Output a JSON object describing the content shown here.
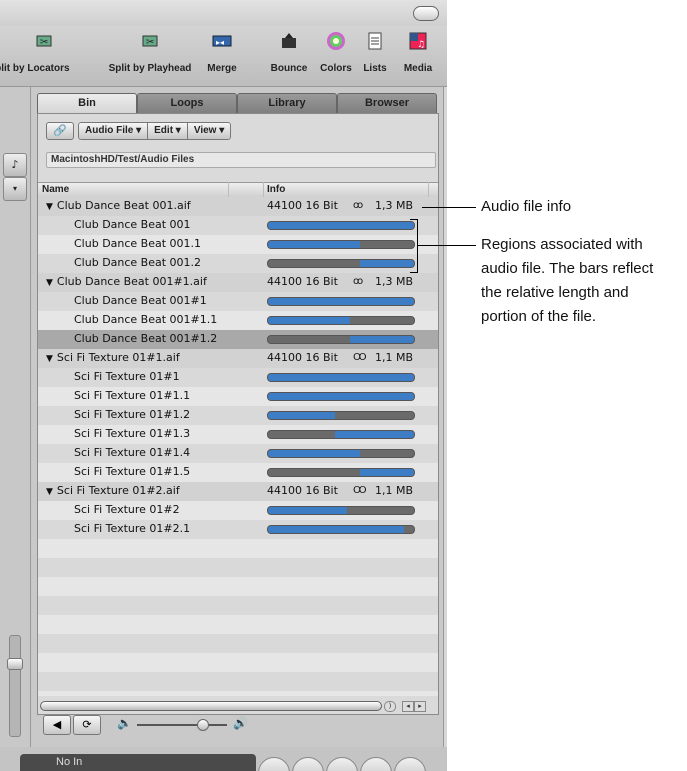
{
  "toolbar": {
    "items": [
      {
        "label": "Split by Locators",
        "icon": "scissors-icon"
      },
      {
        "label": "Split by Playhead",
        "icon": "scissors-icon"
      },
      {
        "label": "Merge",
        "icon": "merge-icon"
      },
      {
        "label": "Bounce",
        "icon": "bounce-icon"
      },
      {
        "label": "Colors",
        "icon": "color-wheel-icon"
      },
      {
        "label": "Lists",
        "icon": "lists-icon"
      },
      {
        "label": "Media",
        "icon": "media-icon"
      }
    ]
  },
  "tabs": [
    {
      "label": "Bin",
      "active": true
    },
    {
      "label": "Loops",
      "active": false
    },
    {
      "label": "Library",
      "active": false
    },
    {
      "label": "Browser",
      "active": false
    }
  ],
  "bin": {
    "menus": [
      "Audio File ▾",
      "Edit ▾",
      "View ▾"
    ],
    "path": "MacintoshHD/Test/Audio Files",
    "columns": {
      "name": "Name",
      "info": "Info"
    },
    "rows": [
      {
        "type": "file",
        "name": "Club Dance Beat 001.aif",
        "rate": "44100 16 Bit",
        "channels": "stereo",
        "size": "1,3 MB"
      },
      {
        "type": "region",
        "name": "Club Dance Beat 001",
        "start": 0.0,
        "length": 1.0
      },
      {
        "type": "region",
        "name": "Club Dance Beat 001.1",
        "start": 0.0,
        "length": 0.63
      },
      {
        "type": "region",
        "name": "Club Dance Beat 001.2",
        "start": 0.63,
        "length": 0.37
      },
      {
        "type": "file",
        "name": "Club Dance Beat 001#1.aif",
        "rate": "44100 16 Bit",
        "channels": "stereo",
        "size": "1,3 MB"
      },
      {
        "type": "region",
        "name": "Club Dance Beat 001#1",
        "start": 0.0,
        "length": 1.0
      },
      {
        "type": "region",
        "name": "Club Dance Beat 001#1.1",
        "start": 0.0,
        "length": 0.56
      },
      {
        "type": "region",
        "name": "Club Dance Beat 001#1.2",
        "start": 0.56,
        "length": 0.44,
        "selected": true
      },
      {
        "type": "file",
        "name": "Sci Fi Texture 01#1.aif",
        "rate": "44100 16 Bit",
        "channels": "mono",
        "size": "1,1 MB"
      },
      {
        "type": "region",
        "name": "Sci Fi Texture 01#1",
        "start": 0.0,
        "length": 1.0
      },
      {
        "type": "region",
        "name": "Sci Fi Texture 01#1.1",
        "start": 0.0,
        "length": 1.0
      },
      {
        "type": "region",
        "name": "Sci Fi Texture 01#1.2",
        "start": 0.0,
        "length": 0.46
      },
      {
        "type": "region",
        "name": "Sci Fi Texture 01#1.3",
        "start": 0.46,
        "length": 0.54
      },
      {
        "type": "region",
        "name": "Sci Fi Texture 01#1.4",
        "start": 0.0,
        "length": 0.63
      },
      {
        "type": "region",
        "name": "Sci Fi Texture 01#1.5",
        "start": 0.63,
        "length": 0.37
      },
      {
        "type": "file",
        "name": "Sci Fi Texture 01#2.aif",
        "rate": "44100 16 Bit",
        "channels": "mono",
        "size": "1,1 MB"
      },
      {
        "type": "region",
        "name": "Sci Fi Texture 01#2",
        "start": 0.0,
        "length": 0.54
      },
      {
        "type": "region",
        "name": "Sci Fi Texture 01#2.1",
        "start": 0.0,
        "length": 0.93
      }
    ]
  },
  "bottom_label": "No In",
  "callouts": {
    "file_info": "Audio file info",
    "regions": [
      "Regions associated with",
      "audio file. The bars reflect",
      "the relative length and",
      "portion of the file."
    ]
  },
  "colors": {
    "bar_fill": "#3d7dc6",
    "bar_track": "#6a6a6a"
  }
}
